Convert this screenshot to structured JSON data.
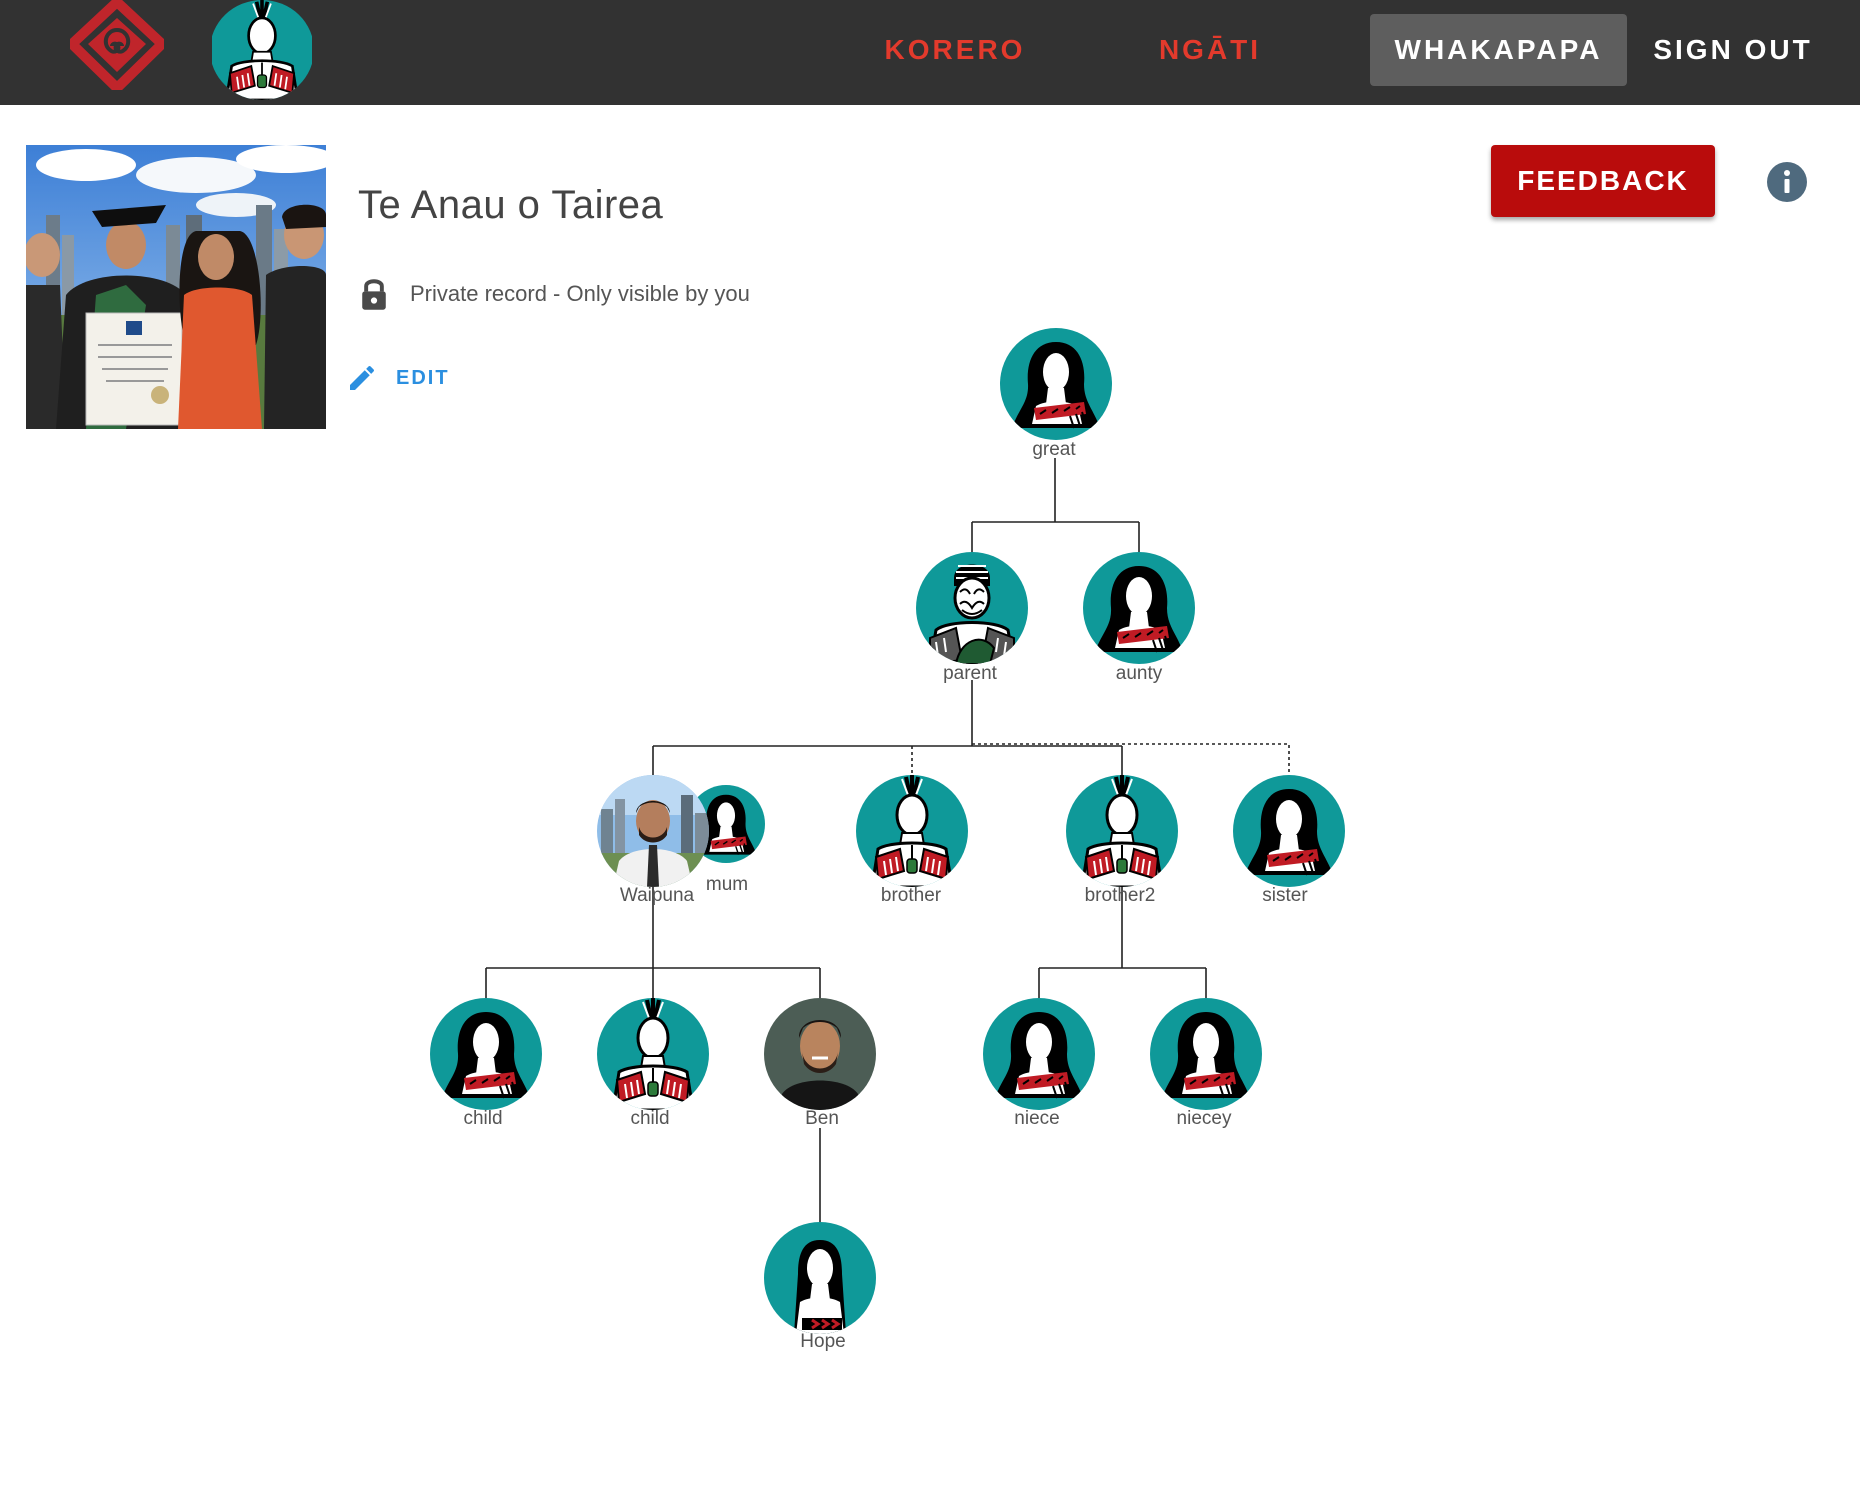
{
  "nav": {
    "logo": "kowhaiwhai-logo-icon",
    "avatar": "wahine-avatar-icon",
    "items": [
      {
        "label": "KORERO",
        "color": "#e33a2c",
        "active": false
      },
      {
        "label": "NGĀTI",
        "color": "#e33a2c",
        "active": false
      },
      {
        "label": "WHAKAPAPA",
        "color": "#ffffff",
        "active": true
      },
      {
        "label": "SIGN OUT",
        "color": "#ffffff",
        "active": false
      }
    ]
  },
  "profile": {
    "name": "Te Anau o Tairea",
    "privacy": "Private record - Only visible by you",
    "edit_label": "EDIT",
    "photo": "graduation-photo"
  },
  "actions": {
    "feedback_label": "FEEDBACK",
    "info": "info-icon"
  },
  "colors": {
    "topbar": "#323232",
    "accent_red": "#e33a2c",
    "feedback_red": "#b90c0c",
    "avatar_teal": "#0f9999",
    "edit_blue": "#2b8fe0"
  },
  "tree": {
    "nodes": [
      {
        "id": "great",
        "label": "great",
        "avatar": "wahine-long-hair-icon"
      },
      {
        "id": "parent",
        "label": "parent",
        "avatar": "kaumatua-moko-icon"
      },
      {
        "id": "aunty",
        "label": "aunty",
        "avatar": "wahine-long-hair-icon"
      },
      {
        "id": "waipuna",
        "label": "Waipuna",
        "avatar": "photo-waipuna"
      },
      {
        "id": "mum",
        "label": "mum",
        "avatar": "wahine-long-hair-icon"
      },
      {
        "id": "brother",
        "label": "brother",
        "avatar": "tane-feather-icon"
      },
      {
        "id": "brother2",
        "label": "brother2",
        "avatar": "tane-feather-icon"
      },
      {
        "id": "sister",
        "label": "sister",
        "avatar": "wahine-long-hair-icon"
      },
      {
        "id": "child1",
        "label": "child",
        "avatar": "wahine-long-hair-icon"
      },
      {
        "id": "child2",
        "label": "child",
        "avatar": "tane-feather-icon"
      },
      {
        "id": "ben",
        "label": "Ben",
        "avatar": "photo-ben"
      },
      {
        "id": "niece",
        "label": "niece",
        "avatar": "wahine-long-hair-icon"
      },
      {
        "id": "niecey",
        "label": "niecey",
        "avatar": "wahine-long-hair-icon"
      },
      {
        "id": "hope",
        "label": "Hope",
        "avatar": "wahine-straight-hair-icon"
      }
    ]
  }
}
